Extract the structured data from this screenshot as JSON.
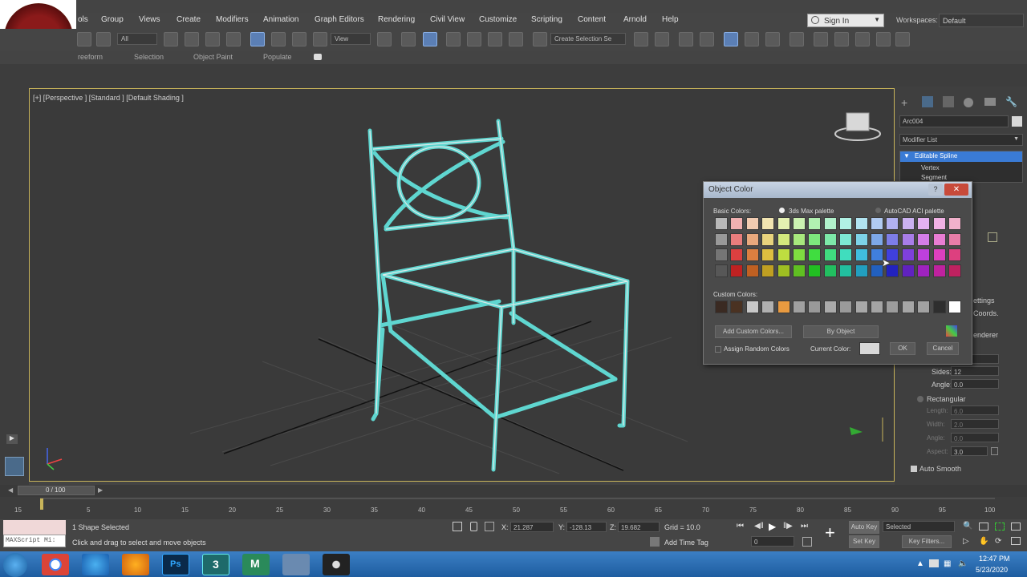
{
  "menu": [
    "ols",
    "Group",
    "Views",
    "Create",
    "Modifiers",
    "Animation",
    "Graph Editors",
    "Rendering",
    "Civil View",
    "Customize",
    "Scripting",
    "Content",
    "Arnold",
    "Help"
  ],
  "signin": "Sign In",
  "workspaces_label": "Workspaces:",
  "workspaces_value": "Default",
  "toolbar": {
    "filter_value": "All",
    "refcoord_value": "View",
    "selection_set": "Create Selection Se"
  },
  "ribbon": [
    "reeform",
    "Selection",
    "Object Paint",
    "Populate"
  ],
  "viewport_label": "[+] [Perspective ] [Standard ] [Default Shading ]",
  "command_panel": {
    "object_name": "Arc004",
    "modifier_list": "Modifier List",
    "stack": [
      "Editable Spline",
      "Vertex",
      "Segment"
    ],
    "partial_labels": [
      "ettings",
      "Coords.",
      "enderer"
    ],
    "sides_label": "Sides:",
    "sides_value": "12",
    "angle_label": "Angle:",
    "angle_value": "0.0",
    "rectangular_label": "Rectangular",
    "length_label": "Length:",
    "length_value": "6.0",
    "width_label": "Width:",
    "width_value": "2.0",
    "angle2_label": "Angle:",
    "angle2_value": "0.0",
    "aspect_label": "Aspect:",
    "aspect_value": "3.0",
    "auto_smooth": "Auto Smooth"
  },
  "dialog": {
    "title": "Object Color",
    "basic_colors_label": "Basic Colors:",
    "palette_max": "3ds Max palette",
    "palette_aci": "AutoCAD ACI palette",
    "custom_colors_label": "Custom Colors:",
    "add_custom": "Add Custom Colors...",
    "by_object": "By Object",
    "assign_random": "Assign Random Colors",
    "current_color_label": "Current Color:",
    "ok": "OK",
    "cancel": "Cancel",
    "current_color": "#d8d8d8"
  },
  "timeline": {
    "frame_counter": "0 / 100",
    "ticks": [
      "5",
      "10",
      "15",
      "20",
      "25",
      "30",
      "35",
      "40",
      "45",
      "50",
      "55",
      "60",
      "65",
      "70",
      "75",
      "80",
      "85",
      "90",
      "95",
      "100"
    ],
    "tick0": "15"
  },
  "status": {
    "maxscript": "MAXScript Mi:",
    "selected": "1 Shape Selected",
    "prompt": "Click and drag to select and move objects",
    "x_label": "X:",
    "x_value": "21.287",
    "y_label": "Y:",
    "y_value": "-128.13",
    "z_label": "Z:",
    "z_value": "19.682",
    "grid": "Grid = 10.0",
    "add_time_tag": "Add Time Tag",
    "auto_key": "Auto Key",
    "set_key": "Set Key",
    "selected_dropdown": "Selected",
    "key_filters": "Key Filters...",
    "frame_field": "0"
  },
  "taskbar": {
    "time": "12:47 PM",
    "date": "5/23/2020"
  },
  "colors": {
    "chair_wire": "#5fd6d0",
    "viewport_border": "#c8b45a",
    "selection_highlight": "#3a7bd5"
  }
}
